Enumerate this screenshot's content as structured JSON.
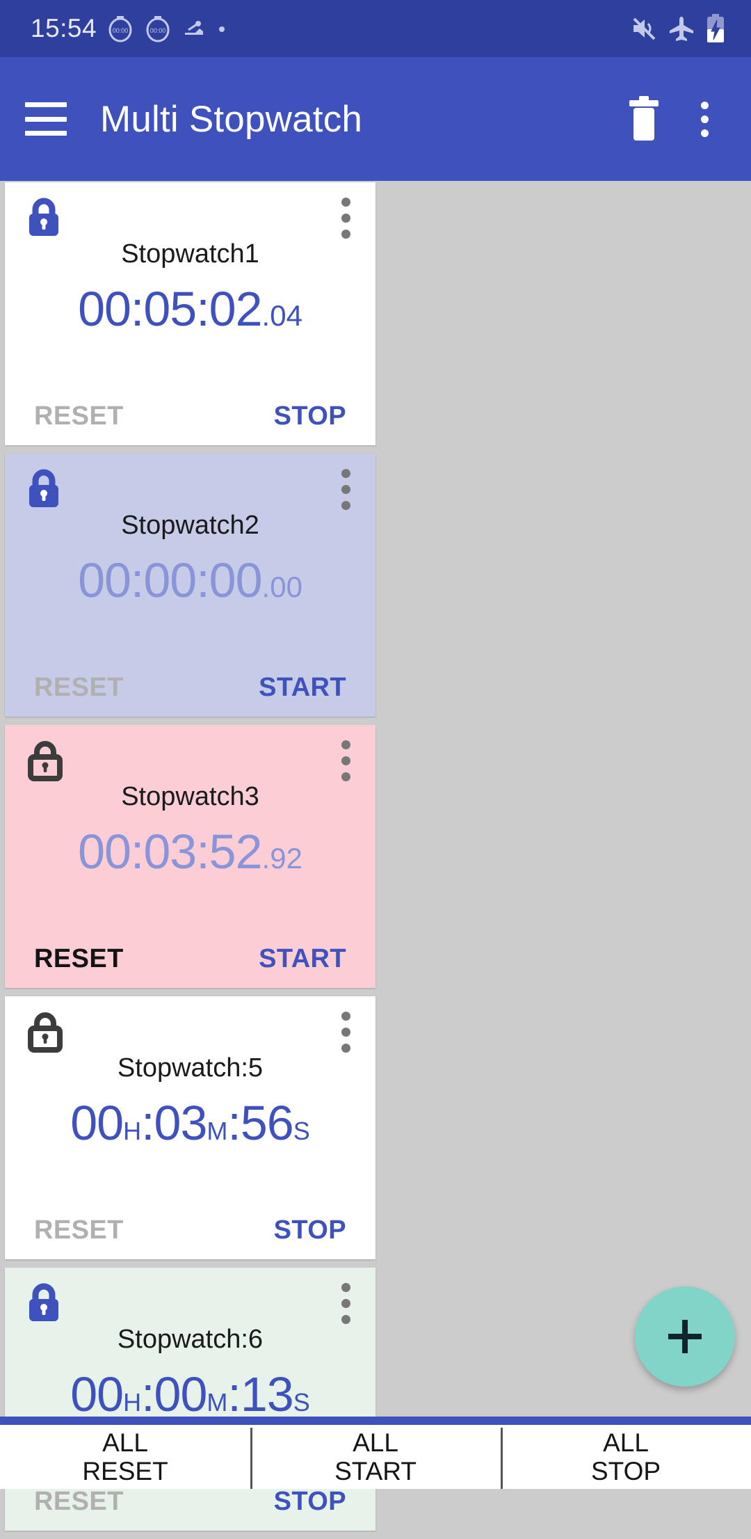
{
  "status_bar": {
    "clock": "15:54",
    "notification_icons": [
      "stopwatch-icon",
      "stopwatch-icon",
      "app-icon",
      "dot-icon"
    ],
    "notification_icon_label": "00:00",
    "system_icons": [
      "mute-icon",
      "airplane-mode-icon",
      "battery-charging-icon"
    ],
    "background_color": "#2f3f9e"
  },
  "app_bar": {
    "menu_label": "menu",
    "title": "Multi Stopwatch",
    "delete_label": "delete",
    "overflow_label": "more options",
    "background_color": "#3f51bc"
  },
  "theme": {
    "accent": "#3f51bc",
    "accent_dim": "#8a94d8",
    "disabled": "#b0b0b0",
    "page_background": "#cccccc",
    "fab_color": "#80d4c8"
  },
  "stopwatches": [
    {
      "name": "Stopwatch1",
      "locked": true,
      "lock_icon": "lock-closed-icon",
      "background_color": "#ffffff",
      "time_format": "hms-fraction",
      "time_main": "00:05:02",
      "time_fraction": ".04",
      "running": true,
      "dim": false,
      "reset_label": "RESET",
      "reset_enabled": false,
      "toggle_label": "STOP"
    },
    {
      "name": "Stopwatch2",
      "locked": true,
      "lock_icon": "lock-closed-icon",
      "background_color": "#c6cbe8",
      "time_format": "hms-fraction",
      "time_main": "00:00:00",
      "time_fraction": ".00",
      "running": false,
      "dim": true,
      "reset_label": "RESET",
      "reset_enabled": false,
      "toggle_label": "START"
    },
    {
      "name": "Stopwatch3",
      "locked": false,
      "lock_icon": "lock-open-icon",
      "background_color": "#fbcdd4",
      "time_format": "hms-fraction",
      "time_main": "00:03:52",
      "time_fraction": ".92",
      "running": false,
      "dim": true,
      "reset_label": "RESET",
      "reset_enabled": true,
      "toggle_label": "START"
    },
    {
      "name": "Stopwatch:5",
      "locked": false,
      "lock_icon": "lock-open-icon",
      "background_color": "#ffffff",
      "time_format": "units",
      "hours": "00",
      "hours_unit": "H",
      "minutes": "03",
      "minutes_unit": "M",
      "seconds": "56",
      "seconds_unit": "S",
      "running": true,
      "dim": false,
      "reset_label": "RESET",
      "reset_enabled": false,
      "toggle_label": "STOP"
    },
    {
      "name": "Stopwatch:6",
      "locked": true,
      "lock_icon": "lock-closed-icon",
      "background_color": "#e7f2ea",
      "time_format": "units",
      "hours": "00",
      "hours_unit": "H",
      "minutes": "00",
      "minutes_unit": "M",
      "seconds": "13",
      "seconds_unit": "S",
      "running": true,
      "dim": false,
      "reset_label": "RESET",
      "reset_enabled": false,
      "toggle_label": "STOP"
    }
  ],
  "fab": {
    "icon": "plus-icon",
    "label": "add stopwatch"
  },
  "bottom_bar": [
    {
      "line1": "ALL",
      "line2": "RESET"
    },
    {
      "line1": "ALL",
      "line2": "START"
    },
    {
      "line1": "ALL",
      "line2": "STOP"
    }
  ]
}
